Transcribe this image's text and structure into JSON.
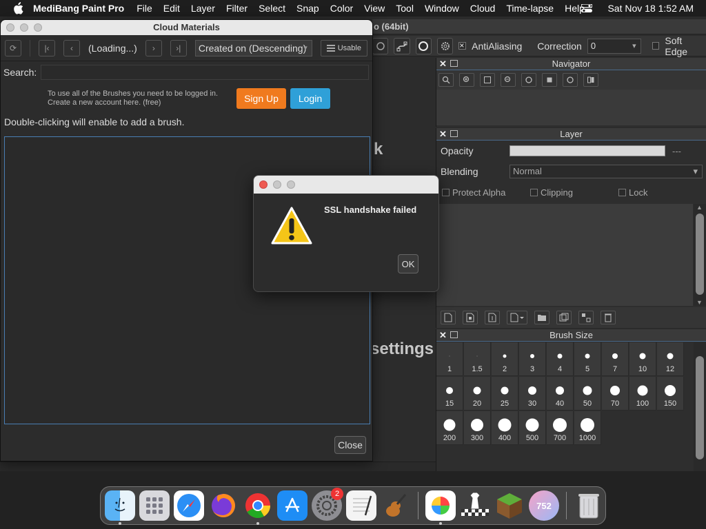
{
  "menubar": {
    "app_name": "MediBang Paint Pro",
    "items": [
      "File",
      "Edit",
      "Layer",
      "Filter",
      "Select",
      "Snap",
      "Color",
      "View",
      "Tool",
      "Window",
      "Cloud",
      "Time-lapse",
      "Help"
    ],
    "datetime": "Sat Nov 18  1:52 AM"
  },
  "main_window": {
    "title_fragment": "o (64bit)",
    "toolbar": {
      "antialiasing_label": "AntiAliasing",
      "antialiasing_checked": true,
      "correction_label": "Correction",
      "correction_value": "0",
      "soft_edge_label": "Soft Edge",
      "soft_edge_checked": false
    },
    "canvas_fragments": [
      "k",
      "settings"
    ]
  },
  "navigator": {
    "title": "Navigator"
  },
  "layer": {
    "title": "Layer",
    "opacity_label": "Opacity",
    "opacity_value": "---",
    "blending_label": "Blending",
    "blending_value": "Normal",
    "protect_alpha_label": "Protect Alpha",
    "clipping_label": "Clipping",
    "lock_label": "Lock"
  },
  "brush_size": {
    "title": "Brush Size",
    "sizes": [
      "1",
      "1.5",
      "2",
      "3",
      "4",
      "5",
      "7",
      "10",
      "12",
      "15",
      "20",
      "25",
      "30",
      "40",
      "50",
      "70",
      "100",
      "150",
      "200",
      "300",
      "400",
      "500",
      "700",
      "1000"
    ]
  },
  "cloud_materials": {
    "title": "Cloud Materials",
    "loading_text": "(Loading...)",
    "sort_value": "Created on (Descending)",
    "usable_label": "Usable",
    "search_label": "Search:",
    "search_value": "",
    "login_message_line1": "To use all of the Brushes you need to be logged in.",
    "login_message_line2": "Create a new account here. (free)",
    "signup_label": "Sign Up",
    "login_label": "Login",
    "hint": "Double-clicking will enable to add a brush.",
    "close_label": "Close"
  },
  "alert": {
    "message": "SSL handshake failed",
    "ok_label": "OK"
  },
  "dock": {
    "apps": [
      "finder-icon",
      "launchpad-icon",
      "safari-icon",
      "firefox-icon",
      "chrome-icon",
      "app-store-icon",
      "system-settings-icon",
      "textedit-icon",
      "garageband-icon",
      "medibang-icon",
      "chess-icon",
      "minecraft-icon",
      "counter-app-icon",
      "trash-icon"
    ],
    "settings_badge": "2",
    "counter_label": "752"
  },
  "colors": {
    "signup": "#f07a1e",
    "login": "#2fa0d8",
    "warning": "#f5c518",
    "close_red": "#ee5a52"
  }
}
